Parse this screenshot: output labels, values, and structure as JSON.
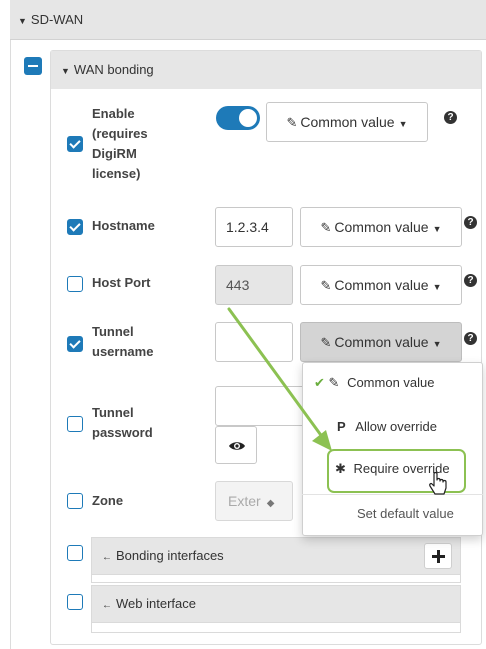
{
  "section": {
    "title": "SD-WAN"
  },
  "subsection": {
    "title": "WAN bonding"
  },
  "rows": {
    "enable": {
      "label": "Enable (requires DigiRM license)",
      "label_lines": [
        "Enable",
        "(requires",
        "DigiRM",
        "license)"
      ],
      "checked": true,
      "toggle_on": true,
      "mode": "Common value"
    },
    "hostname": {
      "label": "Hostname",
      "checked": true,
      "value": "1.2.3.4",
      "mode": "Common value"
    },
    "host_port": {
      "label": "Host Port",
      "checked": false,
      "value": "443",
      "mode": "Common value"
    },
    "tunnel_username": {
      "label_lines": [
        "Tunnel",
        "username"
      ],
      "checked": true,
      "value": "",
      "mode": "Common value"
    },
    "tunnel_password": {
      "label_lines": [
        "Tunnel",
        "password"
      ],
      "checked": false,
      "value": ""
    },
    "zone": {
      "label": "Zone",
      "checked": false,
      "value": "Exter"
    }
  },
  "dropdown": {
    "items": [
      {
        "label": "Common value",
        "selected": true
      },
      {
        "label": "Allow override",
        "selected": false
      },
      {
        "label": "Require override",
        "selected": false,
        "highlighted": true
      }
    ],
    "footer": "Set default value"
  },
  "groups": {
    "bonding_interfaces": "Bonding interfaces",
    "web_interface": "Web interface"
  },
  "colors": {
    "accent": "#1e7ab8",
    "annotation_green": "#8cc152",
    "check_green": "#6aae3d"
  },
  "icons": {
    "help": "question-circle-icon",
    "edit": "edit-icon",
    "eye": "eye-icon",
    "plus": "plus-icon",
    "cursor": "hand-cursor-icon"
  }
}
